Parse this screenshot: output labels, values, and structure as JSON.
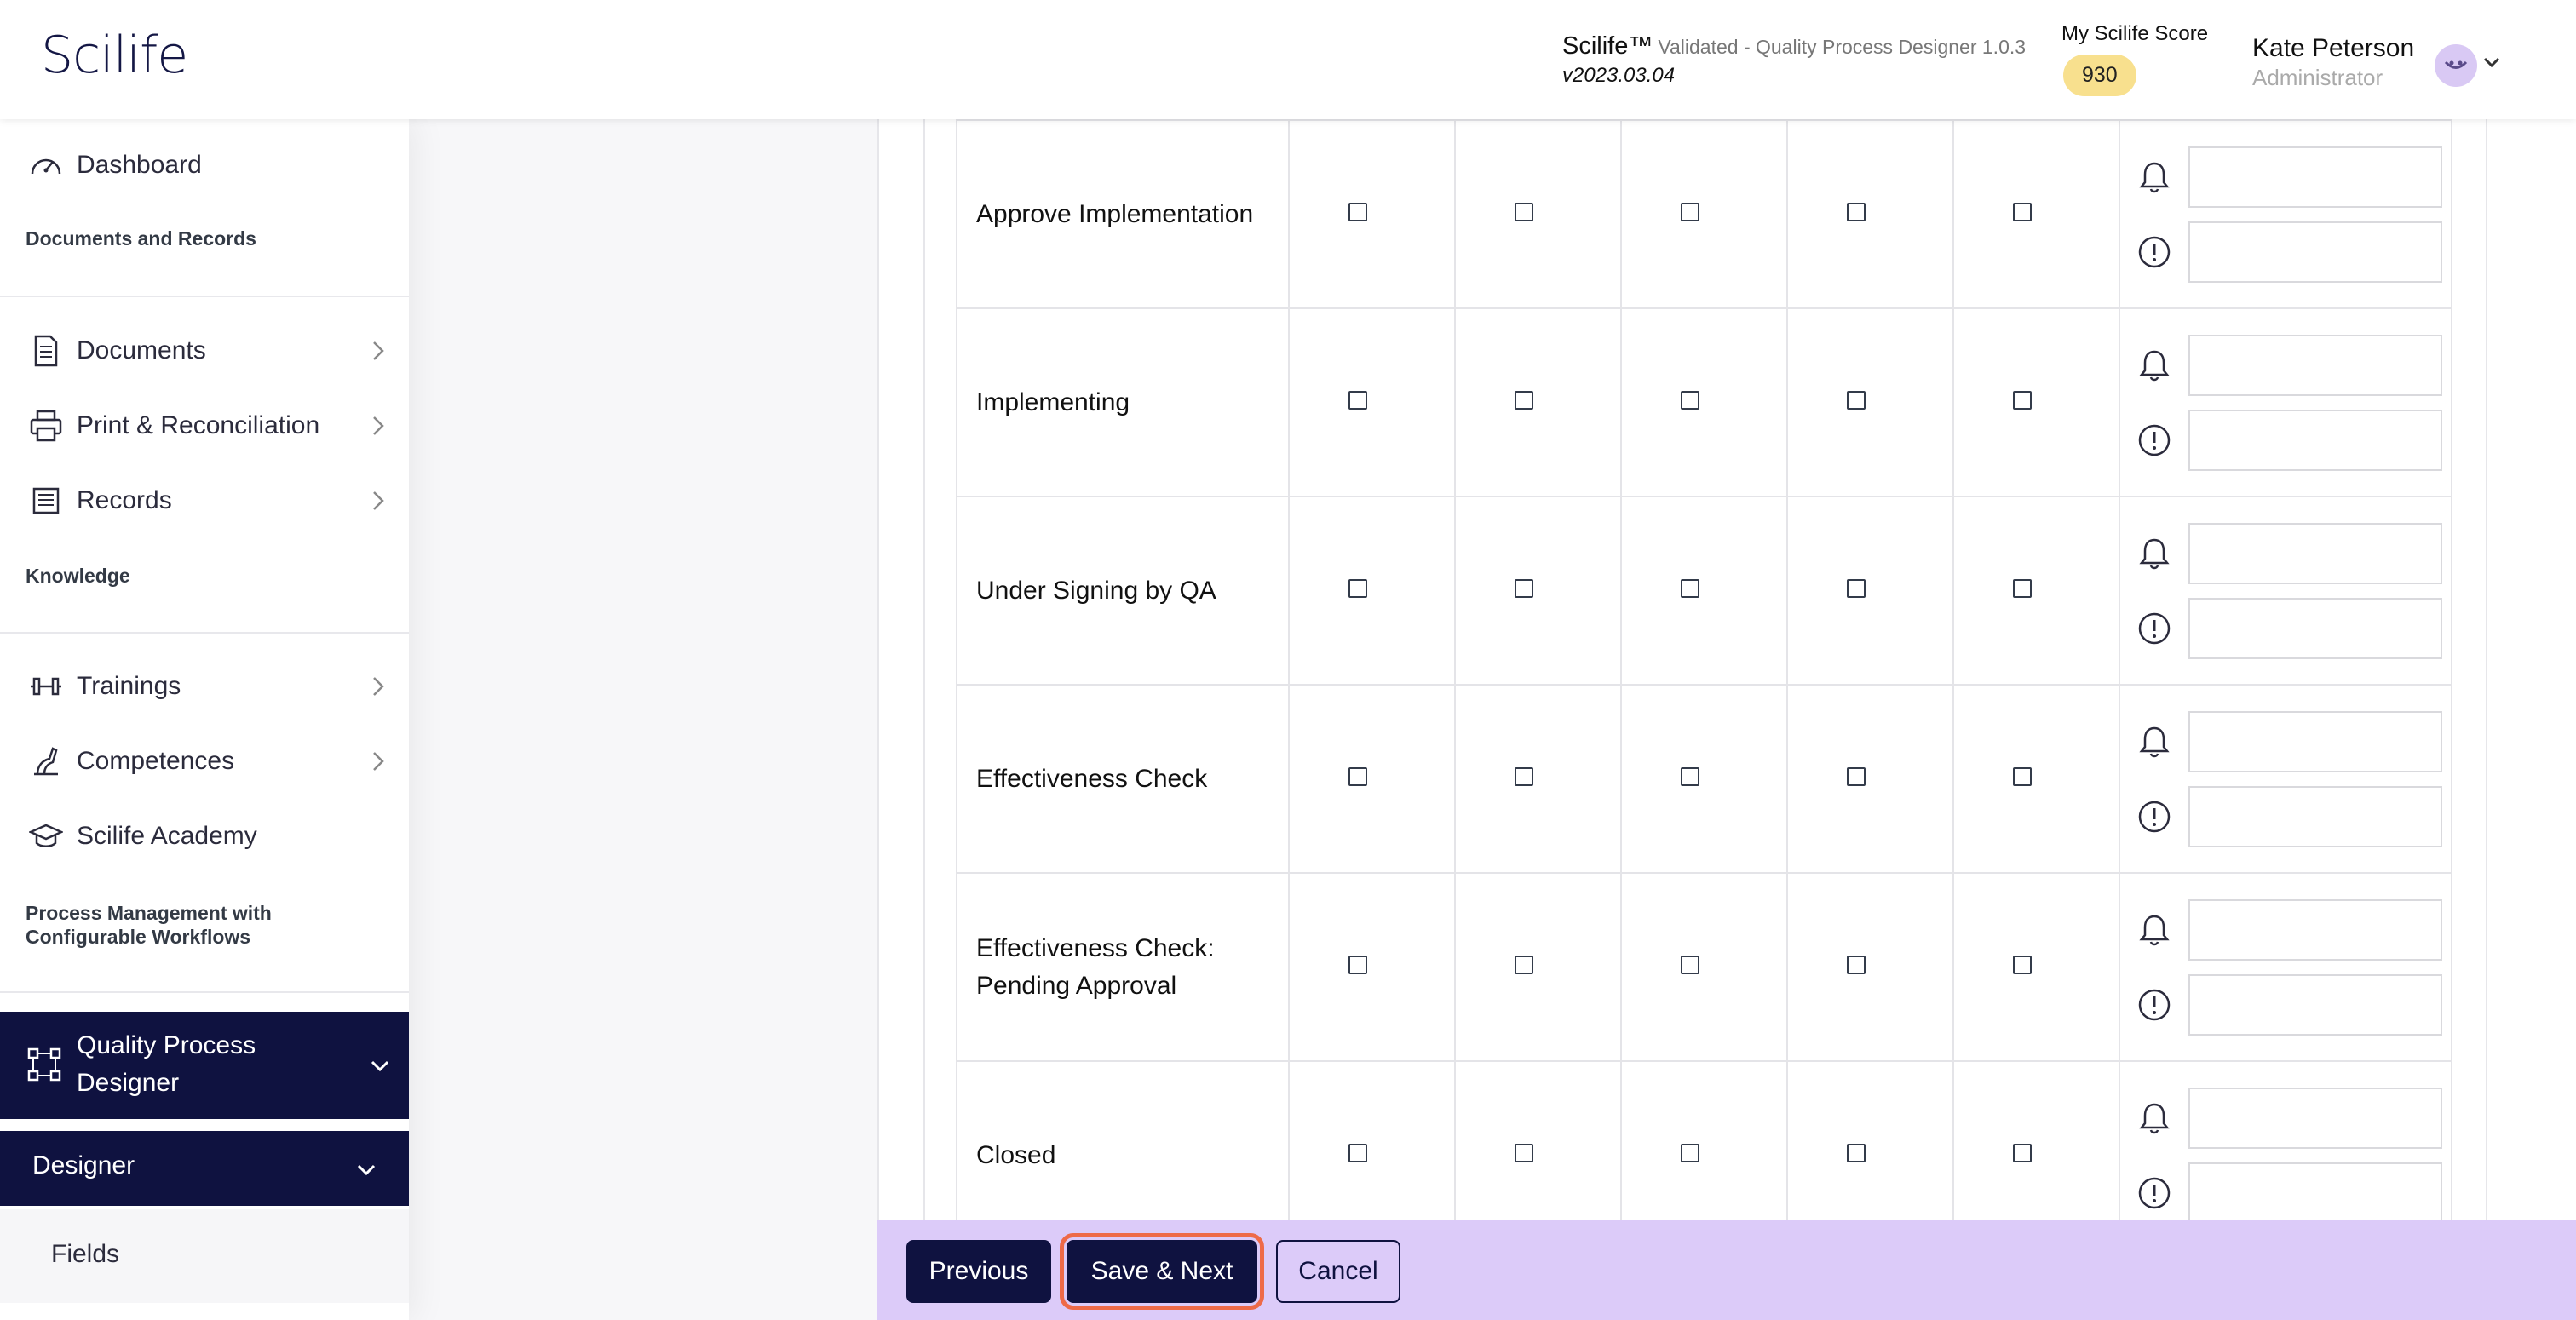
{
  "header": {
    "logo": "Scilife",
    "brand": "Scilife™",
    "app_subtitle": "Validated - Quality Process Designer 1.0.3",
    "version": "v2023.03.04",
    "score_label": "My Scilife Score",
    "score_value": "930",
    "user_name": "Kate Peterson",
    "user_role": "Administrator"
  },
  "sidebar": {
    "dashboard": "Dashboard",
    "section_docs": "Documents and Records",
    "documents": "Documents",
    "print": "Print & Reconciliation",
    "records": "Records",
    "section_knowledge": "Knowledge",
    "trainings": "Trainings",
    "competences": "Competences",
    "academy": "Scilife Academy",
    "section_process": "Process Management with Configurable Workflows",
    "qpd": "Quality Process Designer",
    "designer": "Designer",
    "fields": "Fields"
  },
  "matrix": {
    "rows": [
      "Approve Implementation",
      "Implementing",
      "Under Signing by QA",
      "Effectiveness Check",
      "Effectiveness Check: Pending Approval",
      "Closed"
    ]
  },
  "footer": {
    "previous": "Previous",
    "save_next": "Save & Next",
    "cancel": "Cancel"
  },
  "colors": {
    "navy": "#0f1240",
    "footer_bg": "#dccbf9",
    "score_badge": "#f8e08e",
    "highlight": "#ee6a48"
  },
  "icons": [
    "dashboard-icon",
    "document-icon",
    "printer-icon",
    "records-icon",
    "dumbbell-icon",
    "competence-icon",
    "academy-icon",
    "workflow-icon",
    "bell-icon",
    "alert-icon",
    "chevron-right-icon",
    "chevron-down-icon"
  ]
}
